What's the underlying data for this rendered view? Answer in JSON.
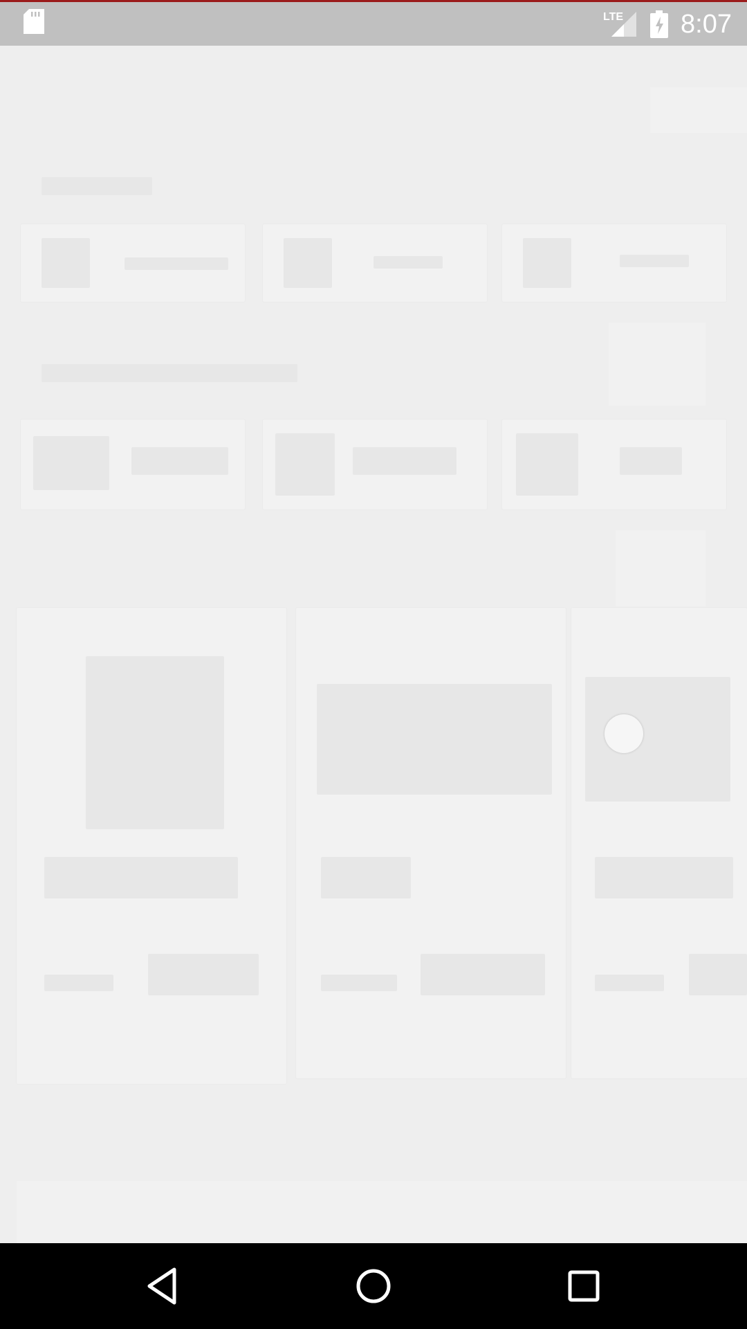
{
  "status_bar": {
    "time": "8:07",
    "network": "LTE",
    "icons": [
      "sd-card-icon",
      "lte-signal-icon",
      "battery-charging-icon"
    ]
  },
  "nav_bar": {
    "icons": [
      "back-icon",
      "home-icon",
      "recents-icon"
    ]
  },
  "colors": {
    "status_bar_bg": "#c0c0c0",
    "accent_line": "#9b1b1b",
    "nav_bar_bg": "#000000",
    "content_bg": "#eeeeee"
  }
}
